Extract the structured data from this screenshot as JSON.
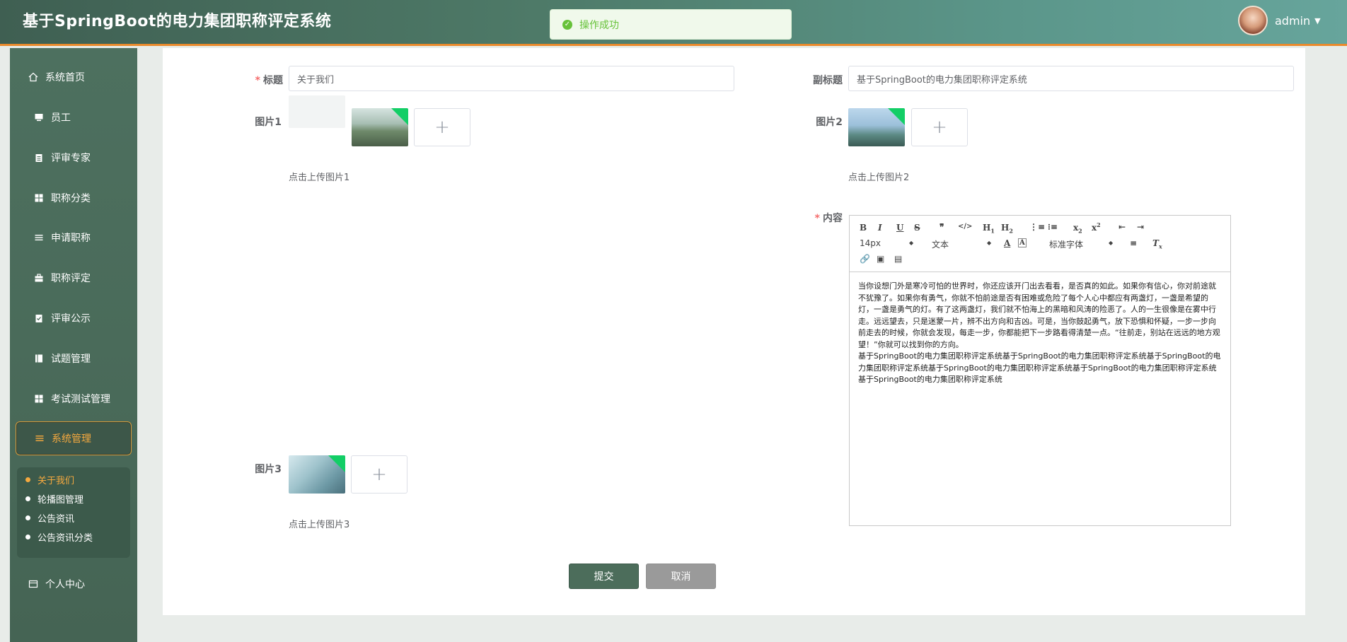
{
  "header": {
    "title": "基于SpringBoot的电力集团职称评定系统",
    "toast": "操作成功",
    "user": "admin"
  },
  "sidebar": {
    "items": [
      {
        "label": "系统首页",
        "icon": "home-icon"
      },
      {
        "label": "员工",
        "icon": "monitor-icon"
      },
      {
        "label": "评审专家",
        "icon": "clipboard-icon"
      },
      {
        "label": "职称分类",
        "icon": "grid-icon"
      },
      {
        "label": "申请职称",
        "icon": "list-icon"
      },
      {
        "label": "职称评定",
        "icon": "briefcase-icon"
      },
      {
        "label": "评审公示",
        "icon": "clipboard-check-icon"
      },
      {
        "label": "试题管理",
        "icon": "book-icon"
      },
      {
        "label": "考试测试管理",
        "icon": "grid-icon"
      },
      {
        "label": "系统管理",
        "icon": "menu-icon"
      },
      {
        "label": "个人中心",
        "icon": "card-icon"
      }
    ],
    "submenu": [
      "关于我们",
      "轮播图管理",
      "公告资讯",
      "公告资讯分类"
    ]
  },
  "form": {
    "title_label": "标题",
    "title_value": "关于我们",
    "subtitle_label": "副标题",
    "subtitle_value": "基于SpringBoot的电力集团职称评定系统",
    "pic1_label": "图片1",
    "pic1_hint": "点击上传图片1",
    "pic2_label": "图片2",
    "pic2_hint": "点击上传图片2",
    "pic3_label": "图片3",
    "pic3_hint": "点击上传图片3",
    "content_label": "内容",
    "submit": "提交",
    "cancel": "取消"
  },
  "editor": {
    "font_size": "14px",
    "header_select": "文本",
    "font_family": "标准字体",
    "paragraph1": "当你设想门外是寒冷可怕的世界时，你还应该开门出去看看，是否真的如此。如果你有信心，你对前途就不犹豫了。如果你有勇气，你就不怕前途是否有困难或危险了每个人心中都应有两盏灯，一盏是希望的灯，一盏是勇气的灯。有了这两盏灯，我们就不怕海上的黑暗和风涛的险恶了。人的一生很像是在雾中行走。远远望去，只是迷蒙一片，辨不出方向和吉凶。可是，当你鼓起勇气，放下恐惧和怀疑，一步一步向前走去的时候，你就会发现，每走一步，你都能把下一步路看得清楚一点。“往前走，别站在远远的地方观望！”你就可以找到你的方向。",
    "paragraph2": "基于SpringBoot的电力集团职称评定系统基于SpringBoot的电力集团职称评定系统基于SpringBoot的电力集团职称评定系统基于SpringBoot的电力集团职称评定系统基于SpringBoot的电力集团职称评定系统基于SpringBoot的电力集团职称评定系统"
  },
  "colors": {
    "accent": "#f5a93f",
    "sidebar": "#4a6b5a",
    "submit": "#4c6d5b"
  }
}
